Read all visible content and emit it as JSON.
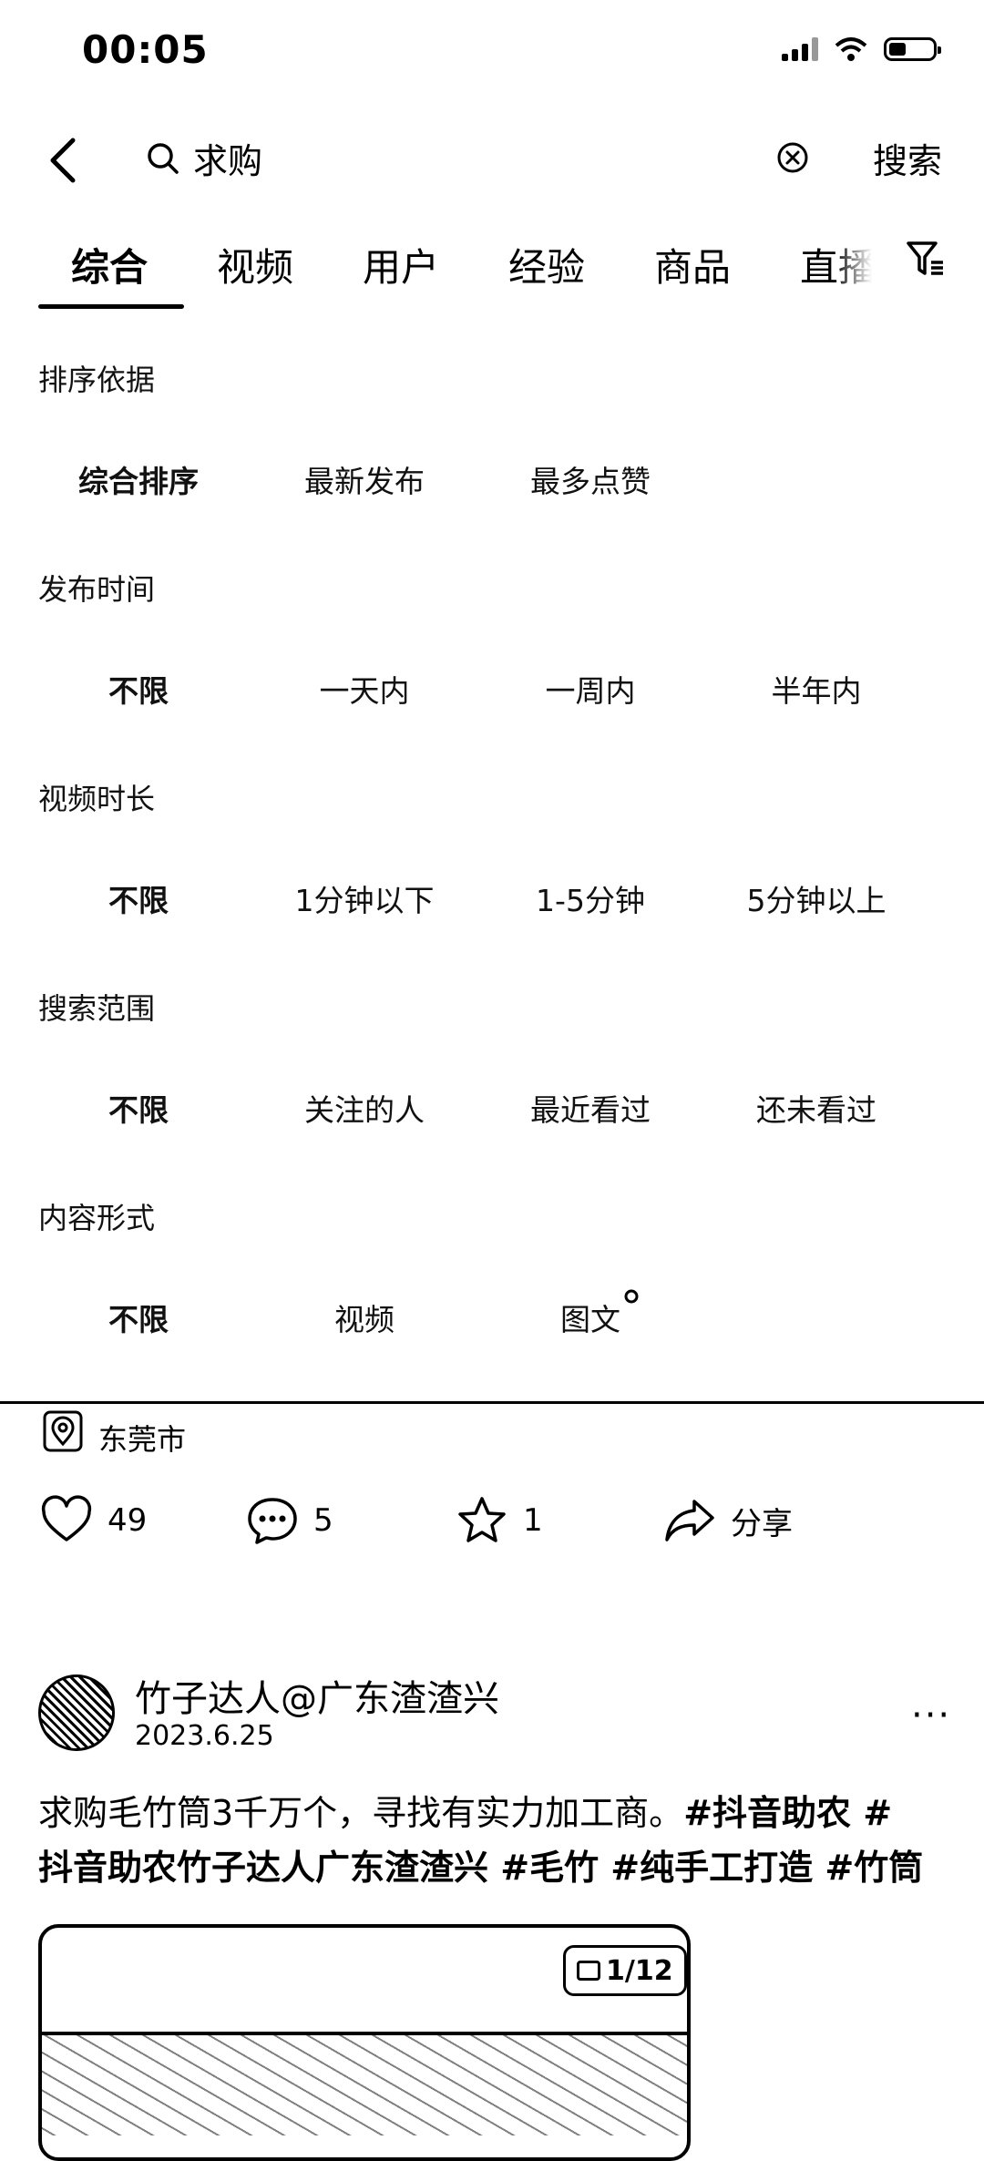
{
  "status_bar": {
    "time": "00:05"
  },
  "search": {
    "query": "求购",
    "submit_label": "搜索"
  },
  "tabs": [
    "综合",
    "视频",
    "用户",
    "经验",
    "商品",
    "直播"
  ],
  "filters": {
    "sort": {
      "title": "排序依据",
      "options": [
        "综合排序",
        "最新发布",
        "最多点赞"
      ]
    },
    "time": {
      "title": "发布时间",
      "options": [
        "不限",
        "一天内",
        "一周内",
        "半年内"
      ]
    },
    "duration": {
      "title": "视频时长",
      "options": [
        "不限",
        "1分钟以下",
        "1-5分钟",
        "5分钟以上"
      ]
    },
    "scope": {
      "title": "搜索范围",
      "options": [
        "不限",
        "关注的人",
        "最近看过",
        "还未看过"
      ]
    },
    "format": {
      "title": "内容形式",
      "options": [
        "不限",
        "视频",
        "图文"
      ]
    }
  },
  "post_prev": {
    "location": "东莞市",
    "likes": "49",
    "comments": "5",
    "favorites": "1",
    "share_label": "分享"
  },
  "post": {
    "author": "竹子达人@广东渣渣兴",
    "date": "2023.6.25",
    "text": "求购毛竹筒3千万个，寻找有实力加工商。",
    "tags_line1": "#抖音助农 #",
    "tags_line2_plain": "抖音助农竹子达人广东渣渣兴 ",
    "tags_line2_rest": "#毛竹 #纯手工打造 #竹筒",
    "more": "···",
    "image_counter": "1/12"
  }
}
